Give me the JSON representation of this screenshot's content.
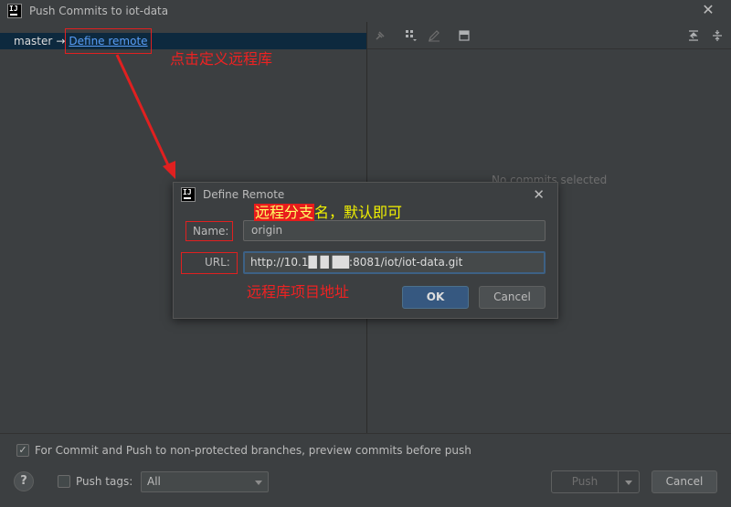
{
  "window": {
    "title": "Push Commits to iot-data",
    "logo": "intellij-logo",
    "logo_text": "IJ"
  },
  "branch": {
    "local": "master",
    "arrow": "→",
    "define_remote_link": "Define remote"
  },
  "right_pane": {
    "empty_text": "No commits selected",
    "toolbar_icons": [
      "pin-icon",
      "group-by-icon",
      "edit-icon",
      "commit-details-icon",
      "expand-all-icon",
      "collapse-all-icon"
    ]
  },
  "bottom": {
    "preview_checkbox_checked": true,
    "preview_label": "For Commit and Push to non-protected branches, preview commits before push",
    "help_label": "?",
    "push_tags_checked": false,
    "push_tags_label": "Push tags:",
    "push_tags_value": "All",
    "push_label": "Push",
    "cancel_label": "Cancel"
  },
  "dialog": {
    "title": "Define Remote",
    "name_label": "Name:",
    "name_value": "origin",
    "url_label": "URL:",
    "url_value": "http://10.1█ █ ██:8081/iot/iot-data.git",
    "ok_label": "OK",
    "cancel_label": "Cancel"
  },
  "annotations": {
    "define_remote_note": "点击定义远程库",
    "branch_note_highlight": "远程分支",
    "branch_note_rest": "名，默认即可",
    "url_note": "远程库项目地址",
    "color": "#e02020"
  }
}
